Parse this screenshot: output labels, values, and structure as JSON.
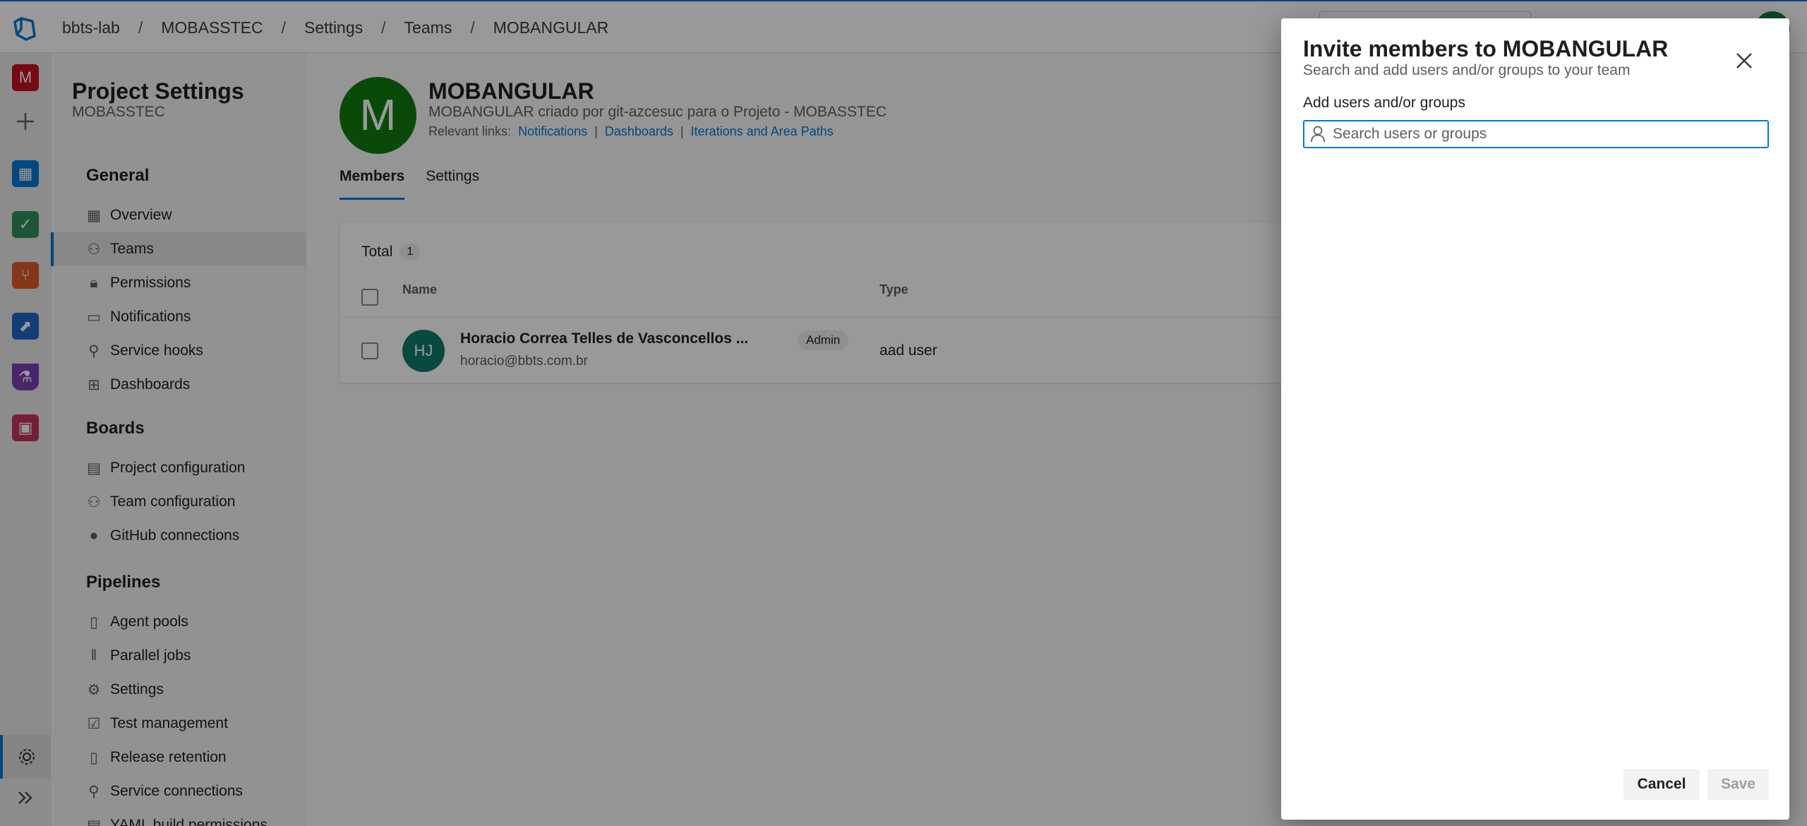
{
  "breadcrumb": [
    "bbts-lab",
    "MOBASSTEC",
    "Settings",
    "Teams",
    "MOBANGULAR"
  ],
  "rail": {
    "project_initial": "M",
    "items": [
      "plus-icon",
      "boards-icon",
      "test-plans-icon",
      "repos-icon",
      "pipelines-icon",
      "artifacts-lab-icon",
      "artifacts-icon"
    ],
    "bottom": [
      "gear-icon",
      "expand-icon"
    ]
  },
  "sidebar": {
    "title": "Project Settings",
    "project": "MOBASSTEC",
    "sections": [
      {
        "title": "General",
        "items": [
          "Overview",
          "Teams",
          "Permissions",
          "Notifications",
          "Service hooks",
          "Dashboards"
        ]
      },
      {
        "title": "Boards",
        "items": [
          "Project configuration",
          "Team configuration",
          "GitHub connections"
        ]
      },
      {
        "title": "Pipelines",
        "items": [
          "Agent pools",
          "Parallel jobs",
          "Settings",
          "Test management",
          "Release retention",
          "Service connections",
          "YAML build permissions"
        ]
      }
    ],
    "active_item": "Teams"
  },
  "team": {
    "initial": "M",
    "name": "MOBANGULAR",
    "description": "MOBANGULAR criado por git-azcesuc para o Projeto - MOBASSTEC",
    "links_label": "Relevant links:",
    "links": [
      "Notifications",
      "Dashboards",
      "Iterations and Area Paths"
    ],
    "tabs": [
      "Members",
      "Settings"
    ],
    "selected_tab": "Members"
  },
  "members": {
    "total_label": "Total",
    "total_count": "1",
    "columns": [
      "Name",
      "Type"
    ],
    "rows": [
      {
        "initials": "HJ",
        "name": "Horacio Correa Telles de Vasconcellos ...",
        "email": "horacio@bbts.com.br",
        "role": "Admin",
        "type": "aad user"
      }
    ]
  },
  "dialog": {
    "title": "Invite members to MOBANGULAR",
    "subtitle": "Search and add users and/or groups to your team",
    "field_label": "Add users and/or groups",
    "search_placeholder": "Search users or groups",
    "cancel_label": "Cancel",
    "save_label": "Save"
  },
  "colors": {
    "accent": "#0078d4",
    "team_avatar": "#107c10",
    "member_avatar": "#0e7a6e",
    "project_tile": "#c50f1f"
  }
}
